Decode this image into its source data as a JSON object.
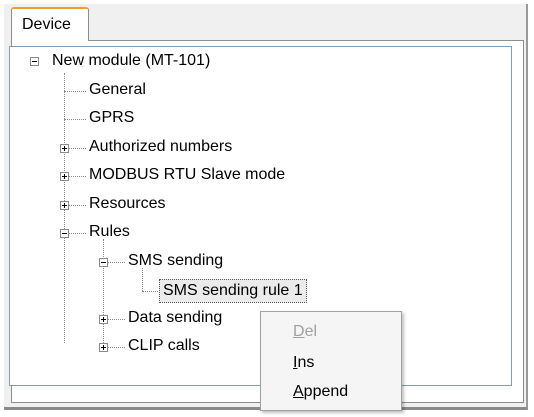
{
  "tab": {
    "label": "Device"
  },
  "tree": {
    "root": "New module  (MT-101)",
    "general": "General",
    "gprs": "GPRS",
    "authorized": "Authorized numbers",
    "modbus": "MODBUS RTU Slave mode",
    "resources": "Resources",
    "rules": "Rules",
    "sms_sending": "SMS sending",
    "sms_rule_1": "SMS sending rule 1",
    "data_sending": "Data sending",
    "clip_calls": "CLIP calls"
  },
  "context_menu": {
    "del": {
      "accel": "D",
      "rest": "el",
      "enabled": false
    },
    "ins": {
      "accel": "I",
      "rest": "ns",
      "enabled": true
    },
    "append": {
      "accel": "A",
      "rest": "ppend",
      "enabled": true
    }
  },
  "colors": {
    "tab_accent": "#f29d2a",
    "selection_bg": "#ebebeb",
    "disabled_text": "#a0a0a0"
  },
  "icons": {
    "collapse": "minus-box-icon",
    "expand": "plus-box-icon"
  }
}
